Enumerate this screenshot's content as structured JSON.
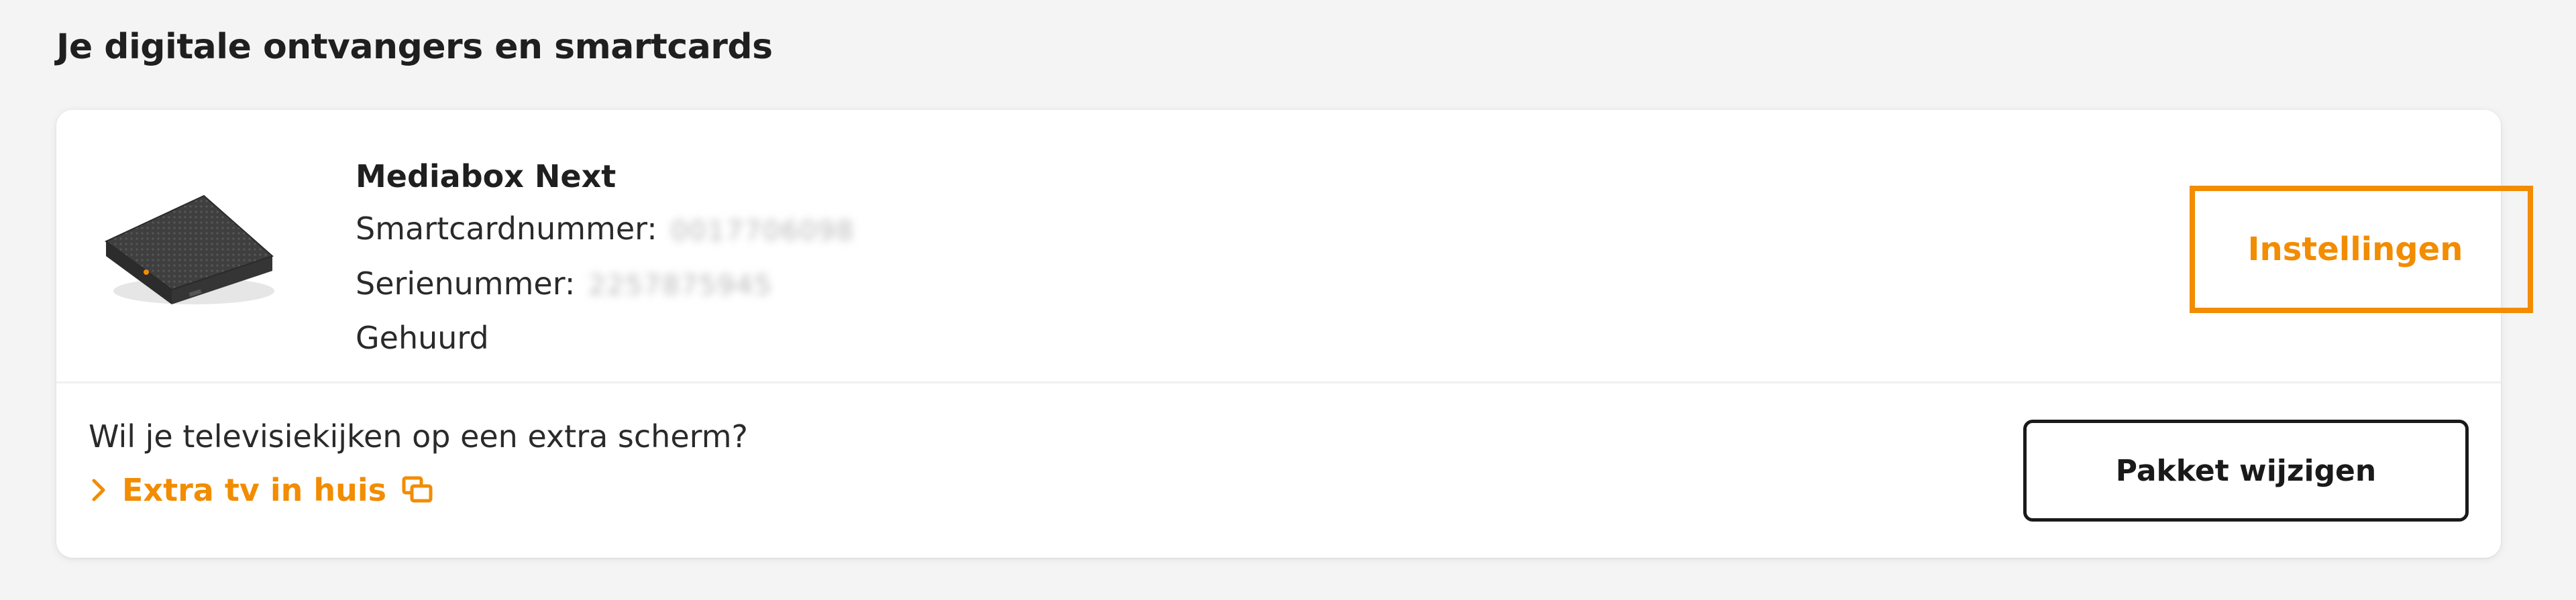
{
  "section": {
    "title": "Je digitale ontvangers en smartcards"
  },
  "device": {
    "image_icon": "set-top-box-image",
    "name": "Mediabox Next",
    "smartcard_label": "Smartcardnummer:",
    "smartcard_value": "0017706098",
    "serial_label": "Serienummer:",
    "serial_value": "2257875945",
    "status": "Gehuurd"
  },
  "actions": {
    "settings_label": "Instellingen",
    "package_label": "Pakket wijzigen"
  },
  "extra": {
    "question": "Wil je televisiekijken op een extra scherm?",
    "link_label": "Extra tv in huis",
    "chevron_icon": "chevron-right-icon",
    "external_icon": "external-link-icon"
  },
  "colors": {
    "accent": "#f28c00",
    "text": "#232323",
    "background": "#f4f4f4"
  }
}
